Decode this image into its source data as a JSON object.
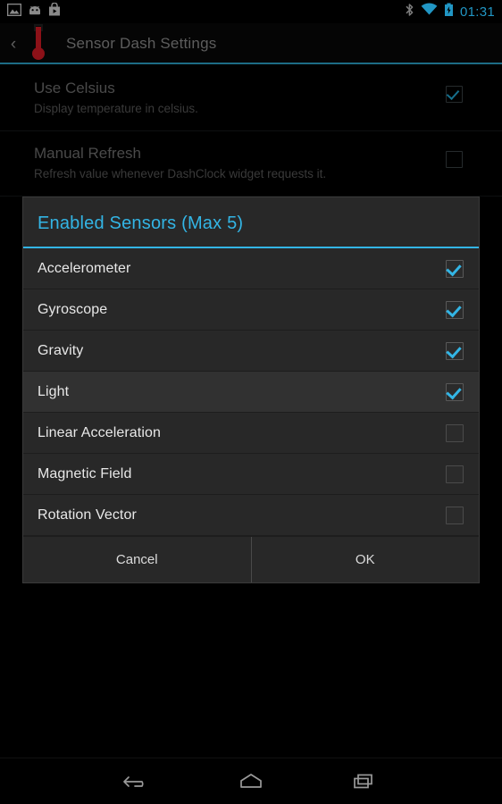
{
  "status_bar": {
    "left_icons": [
      "image-icon",
      "android-head-icon",
      "play-store-icon"
    ],
    "right_icons": [
      "bluetooth-icon",
      "wifi-icon",
      "battery-charging-icon"
    ],
    "clock": "01:31",
    "accent_color": "#2196c4"
  },
  "action_bar": {
    "up_caret": "‹",
    "app_icon": "thermometer-icon",
    "title": "Sensor Dash Settings",
    "underline_color": "#1d6c85"
  },
  "settings": {
    "preferences": [
      {
        "title": "Use Celsius",
        "summary": "Display temperature in celsius.",
        "checked": true
      },
      {
        "title": "Manual Refresh",
        "summary": "Refresh value whenever DashClock widget requests it.",
        "checked": false
      }
    ]
  },
  "dialog": {
    "title": "Enabled Sensors (Max 5)",
    "accent_color": "#33b5e5",
    "sensors": [
      {
        "label": "Accelerometer",
        "checked": true,
        "highlighted": false
      },
      {
        "label": "Gyroscope",
        "checked": true,
        "highlighted": false
      },
      {
        "label": "Gravity",
        "checked": true,
        "highlighted": false
      },
      {
        "label": "Light",
        "checked": true,
        "highlighted": true
      },
      {
        "label": "Linear Acceleration",
        "checked": false,
        "highlighted": false
      },
      {
        "label": "Magnetic Field",
        "checked": false,
        "highlighted": false
      },
      {
        "label": "Rotation Vector",
        "checked": false,
        "highlighted": false
      }
    ],
    "buttons": {
      "cancel": "Cancel",
      "ok": "OK"
    }
  },
  "nav_bar": {
    "buttons": [
      "back-icon",
      "home-icon",
      "recents-icon"
    ]
  }
}
